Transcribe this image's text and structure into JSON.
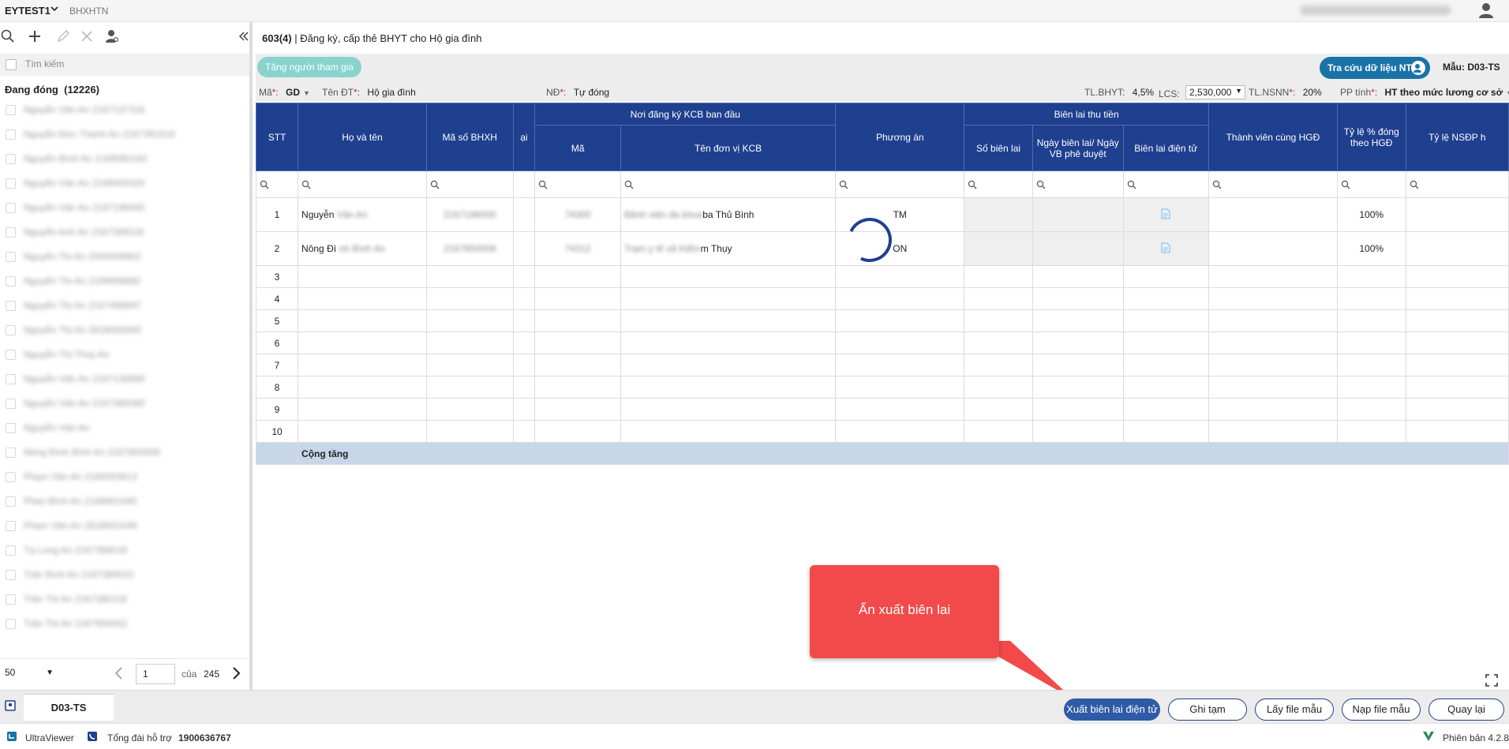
{
  "topbar": {
    "brand": "EYTEST1",
    "subbrand": "BHXHTN",
    "user_blurred": "Công ty TNHH..."
  },
  "sidebar": {
    "search_placeholder": "Tìm kiếm",
    "group_label": "Đang đóng",
    "group_count": "(12226)",
    "items": [
      "Nguyễn Văn An 2167137316",
      "Nguyễn Đức Thành An 2167391516",
      "Nguyễn Bình An 2168060182",
      "Nguyễn Văn An 2169000320",
      "Nguyễn Văn An 2167196000",
      "Nguyễn Anh An 2167389116",
      "Nguyễn Thị An 2000009902",
      "Nguyễn Thị An 2169906882",
      "Nguyễn Thị An 2167498897",
      "Nguyễn Thị An 2818000093",
      "Nguyễn Thị Thùy An",
      "Nguyễn Văn An 2167136886",
      "Nguyễn Văn An 2167385060",
      "Nguyễn Văn An",
      "Nông Đình Bình An 2167850008",
      "Phạm Văn An 2160003913",
      "Phan Bình An 2169901040",
      "Phạm Văn An 2818001049",
      "Tạ Long An 2167388016",
      "Trần Bình An 2167380022",
      "Trần Thị An 2167380118",
      "Trần Thị An 2167950002"
    ],
    "pager": {
      "page_size": "50",
      "page": "1",
      "of_label": "của",
      "total_pages": "245"
    }
  },
  "main": {
    "title_code": "603(4)",
    "title_text": "| Đăng ký, cấp thẻ BHYT cho Hộ gia đình",
    "add_button": "Tăng người tham gia",
    "lookup_button": "Tra cứu dữ liệu NTG",
    "template_label": "Mẫu: D03-TS",
    "fields": {
      "ma_label": "Mã",
      "ma_value": "GD",
      "tendt_label": "Tên ĐT",
      "tendt_value": "Hộ gia đình",
      "nd_label": "NĐ",
      "nd_value": "Tự đóng",
      "tlbhyt_label": "TL.BHYT:",
      "tlbhyt_value": "4,5%",
      "lcs_label": "LCS:",
      "lcs_value": "2,530,000",
      "tlnsnn_label": "TL.NSNN",
      "tlnsnn_value": "20%",
      "pptinh_label": "PP tính",
      "pptinh_value": "HT theo mức lương cơ sở"
    },
    "grid": {
      "headers": {
        "stt": "STT",
        "hoten": "Họ và tên",
        "masobhxh": "Mã số BHXH",
        "partial": "ại",
        "kcb_group": "Nơi đăng ký KCB ban đầu",
        "kcb_ma": "Mã",
        "kcb_ten": "Tên đơn vị KCB",
        "phuongan": "Phương án",
        "bienlai_group": "Biên lai thu tiền",
        "sobienlai": "Số biên lai",
        "ngaybienlai": "Ngày biên lai/ Ngày VB phê duyệt",
        "bienlaidt": "Biên lai điện tử",
        "thanhvien": "Thành viên cùng HGĐ",
        "tyle": "Tỷ lệ % đóng theo HGĐ",
        "tylensdp": "Tỷ lệ NSĐP h"
      },
      "rows": [
        {
          "stt": "1",
          "hoten": "Nguyễn",
          "hoten_blur": "Văn An",
          "masobhxh": "2167196000",
          "ma": "74300",
          "ten_blur": "Bệnh viện đa khoa",
          "ten": "ba Thủ Bình",
          "phuongan": "TM",
          "tyle": "100%"
        },
        {
          "stt": "2",
          "hoten": "Nông Đì",
          "hoten_blur": "nh Bình An",
          "masobhxh": "2167850008",
          "ma": "74312",
          "ten_blur": "Trạm y tế xã Kiểm",
          "ten": "m Thụy",
          "phuongan": "ON",
          "tyle": "100%"
        }
      ],
      "empty_rows": [
        "3",
        "4",
        "5",
        "6",
        "7",
        "8",
        "9",
        "10"
      ],
      "total_label": "Cộng tăng"
    },
    "callout_text": "Ấn xuất biên lai"
  },
  "bottombar": {
    "tab_label": "D03-TS",
    "buttons": {
      "export": "Xuất biên lai điện tử",
      "save_draft": "Ghi tạm",
      "get_template": "Lấy file mẫu",
      "load_template": "Nạp file mẫu",
      "back": "Quay lại"
    }
  },
  "statusbar": {
    "app": "UltraViewer",
    "hotline_label": "Tổng đài hỗ trợ",
    "hotline_number": "1900636767",
    "version": "Phiên bản 4.2.8"
  },
  "colors": {
    "header_blue": "#1f3f8f",
    "callout_red": "#f24a4a",
    "primary_button": "#2f5aa6",
    "teal_button": "#89d3cf"
  }
}
